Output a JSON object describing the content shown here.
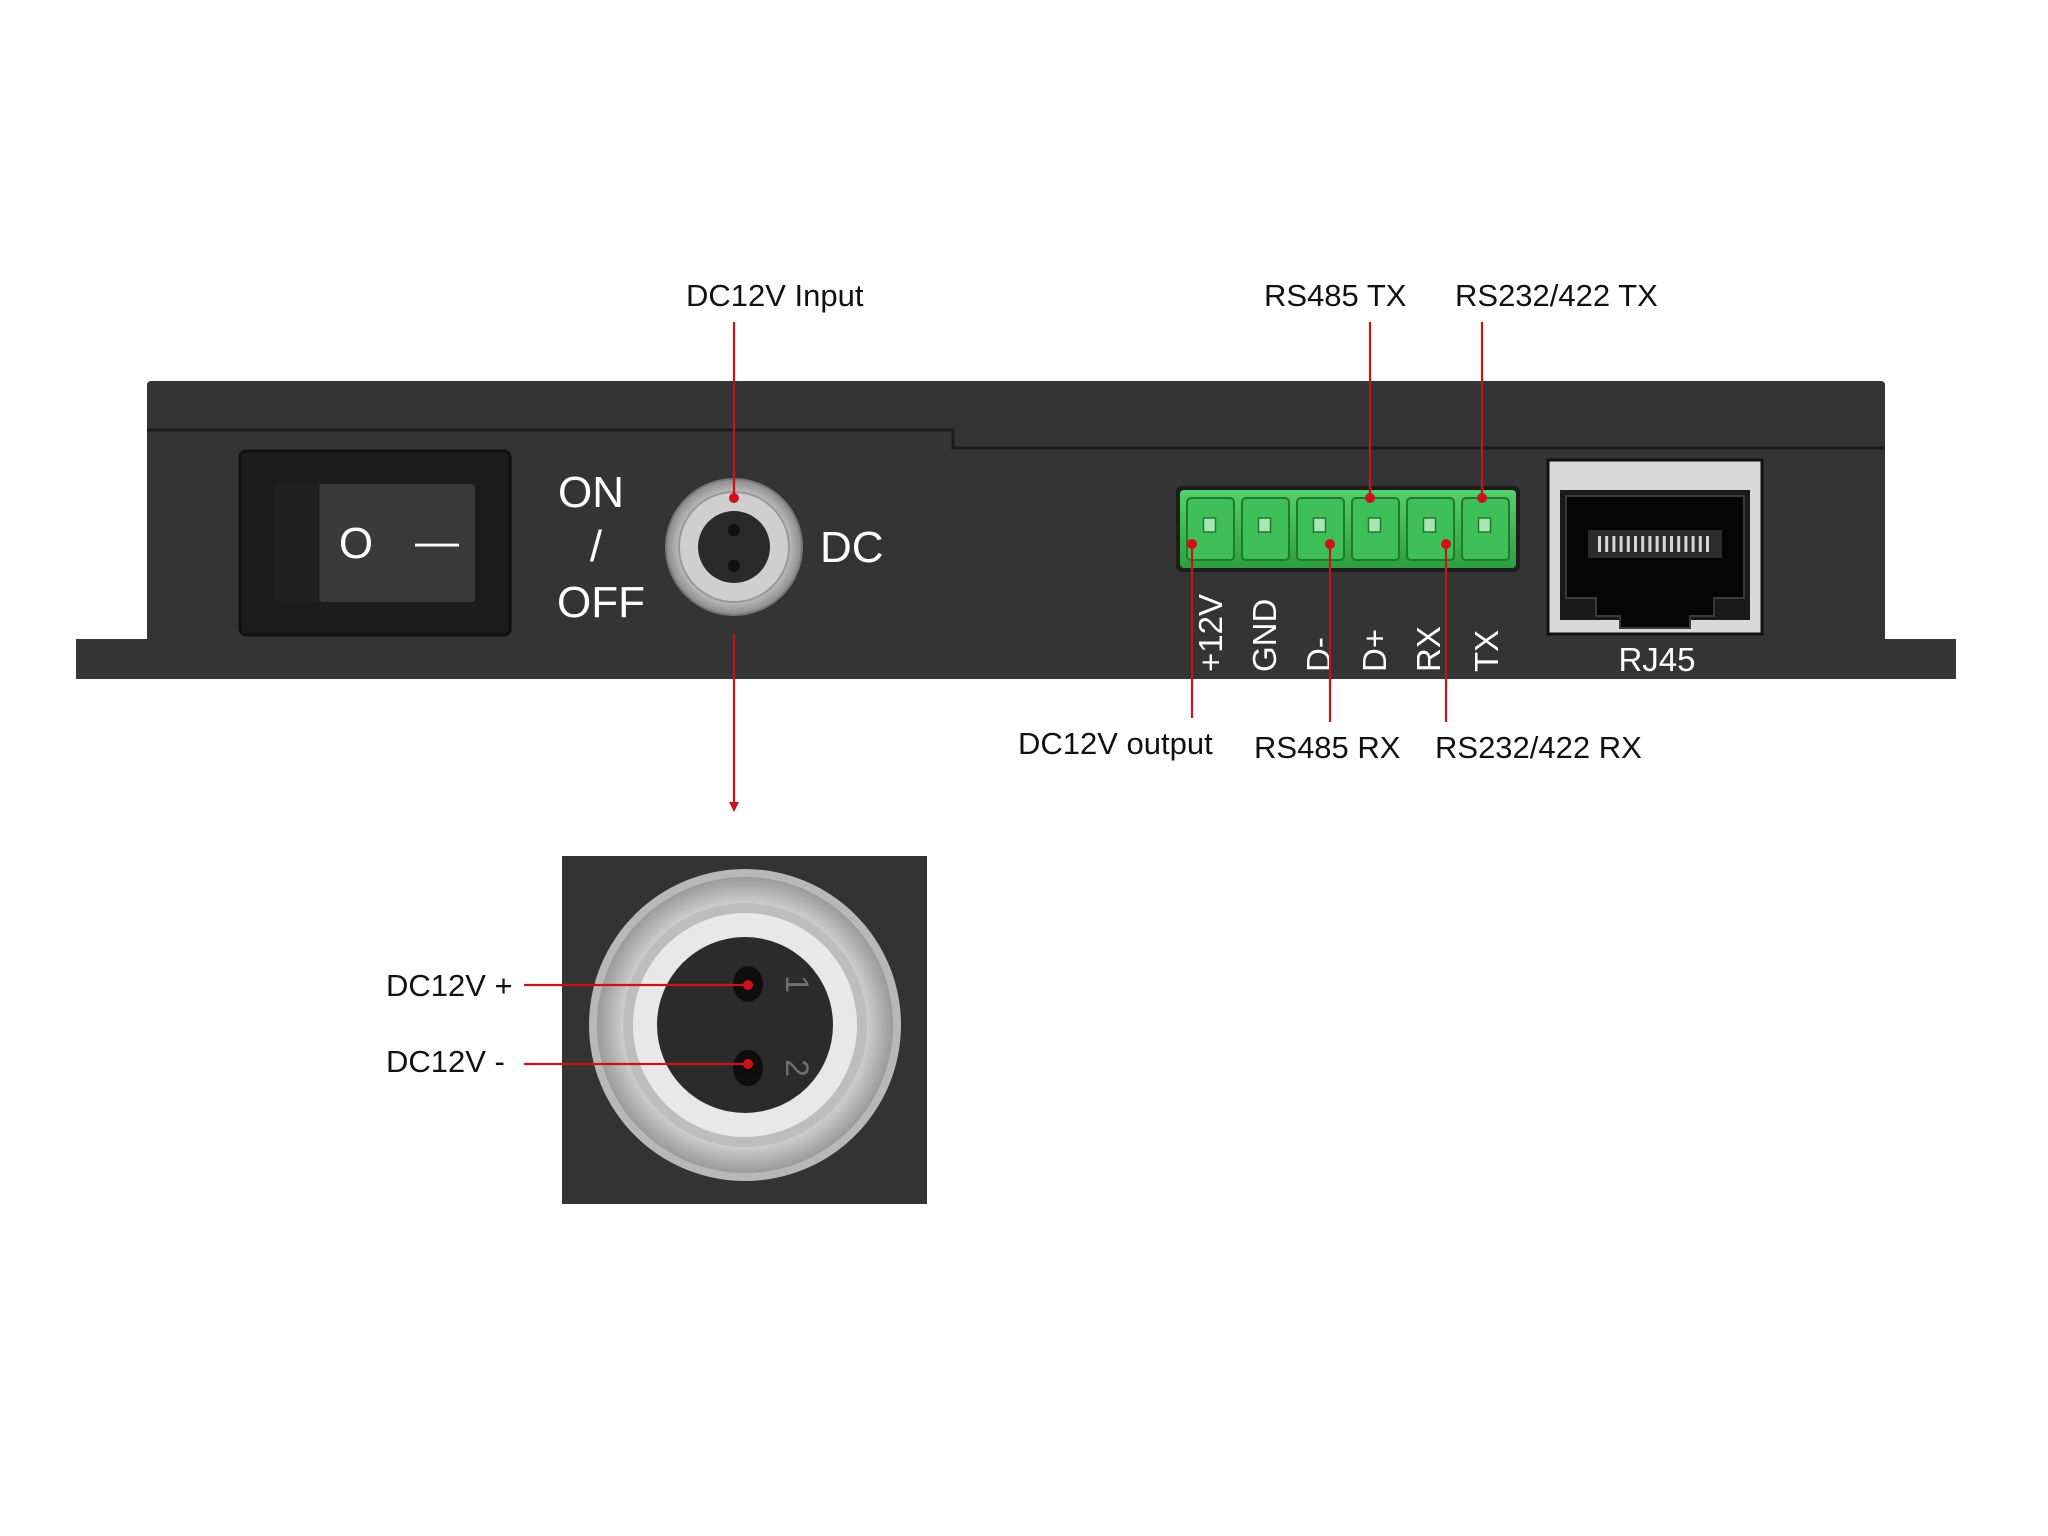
{
  "callouts": {
    "dc_input": "DC12V Input",
    "rs485_tx": "RS485 TX",
    "rs232_422_tx": "RS232/422 TX",
    "dc_output": "DC12V output",
    "rs485_rx": "RS485 RX",
    "rs232_422_rx": "RS232/422 RX",
    "dc_plus": "DC12V +",
    "dc_minus": "DC12V -"
  },
  "device": {
    "switch_off_mark": "O",
    "switch_on_mark": "—",
    "on_label": "ON",
    "slash_label": "/",
    "off_label": "OFF",
    "dc_label": "DC",
    "rj45_label": "RJ45",
    "terminal_pins": [
      "+12V",
      "GND",
      "D-",
      "D+",
      "RX",
      "TX"
    ]
  },
  "jack_pin_numbers": [
    "1",
    "2"
  ],
  "colors": {
    "housing": "#333333",
    "terminal_green": "#37b24d",
    "leader_red": "#c4141c"
  },
  "icons": [
    "rocker-switch-icon",
    "dc-jack-icon",
    "terminal-block-icon",
    "rj45-port-icon"
  ]
}
